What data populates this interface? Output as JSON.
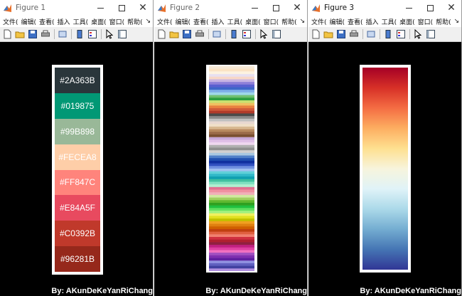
{
  "windows": [
    {
      "title": "Figure 1",
      "menu": [
        "文件(",
        "编辑(",
        "查看(",
        "插入",
        "工具(",
        "桌面(",
        "窗口(",
        "帮助("
      ],
      "menu_more": "↘",
      "credit": "By: AKunDeKeYanRiChang",
      "swatches": [
        {
          "label": "#2A363B",
          "color": "#2A363B"
        },
        {
          "label": "#019875",
          "color": "#019875"
        },
        {
          "label": "#99B898",
          "color": "#99B898"
        },
        {
          "label": "#FECEA8",
          "color": "#FECEA8"
        },
        {
          "label": "#FF847C",
          "color": "#FF847C"
        },
        {
          "label": "#E84A5F",
          "color": "#E84A5F"
        },
        {
          "label": "#C0392B",
          "color": "#C0392B"
        },
        {
          "label": "#96281B",
          "color": "#96281B"
        }
      ]
    },
    {
      "title": "Figure 2",
      "menu": [
        "文件(",
        "编辑(",
        "查看(",
        "插入",
        "工具(",
        "桌面(",
        "窗口(",
        "帮助("
      ],
      "menu_more": "↘",
      "credit": "By: AKunDeKeYanRiChang",
      "stripe_colors": [
        "#f6e9d6",
        "#fbe3c4",
        "#fdf3e0",
        "#e8e0f0",
        "#f7d7c7",
        "#c9b4e3",
        "#8f80d8",
        "#5a5fd0",
        "#3f66c8",
        "#7fb0e8",
        "#9fd8e8",
        "#70c070",
        "#2da040",
        "#c8e070",
        "#f0c060",
        "#e88040",
        "#d05a3a",
        "#b03a2a",
        "#4a4a4a",
        "#8a8a8a",
        "#c0c0c0",
        "#e8d8d0",
        "#f0e0c8",
        "#d8b890",
        "#b88a60",
        "#9a6a48",
        "#7a5030",
        "#c8a8d8",
        "#e0c0e8",
        "#f0d8f0",
        "#b0b0b0",
        "#909090",
        "#d0d0d0",
        "#a8c8e0",
        "#5080c8",
        "#2050b0",
        "#1030a0",
        "#3050c0",
        "#7090e0",
        "#a0c0f0",
        "#60d0d8",
        "#30b8c8",
        "#10a0b0",
        "#40c0a0",
        "#80e0c0",
        "#b0f0d0",
        "#e07090",
        "#f090a0",
        "#f0b0b8",
        "#d0e8a0",
        "#a0d060",
        "#60b830",
        "#30a020",
        "#20c040",
        "#60e060",
        "#a0f080",
        "#f0f060",
        "#e0e020",
        "#c0c000",
        "#f0a020",
        "#e08010",
        "#d06000",
        "#c04010",
        "#e06040",
        "#f08070",
        "#d03040",
        "#b02030",
        "#902040",
        "#c02080",
        "#e040a0",
        "#f070c0",
        "#a050c0",
        "#8030b0",
        "#6020a0",
        "#9090e0",
        "#6060c0",
        "#4040a0",
        "#b090e0"
      ]
    },
    {
      "title": "Figure 3",
      "menu": [
        "文件(",
        "编辑(",
        "查看(",
        "插入",
        "工具(",
        "桌面(",
        "窗口(",
        "帮助("
      ],
      "menu_more": "↘",
      "credit": "By: AKunDeKeYanRiChang",
      "gradient_stops": [
        "#a50026",
        "#d73027",
        "#f46d43",
        "#fdae61",
        "#fee090",
        "#f7f4dc",
        "#e0f3f8",
        "#abd9e9",
        "#74add1",
        "#4575b4",
        "#313695"
      ]
    }
  ]
}
